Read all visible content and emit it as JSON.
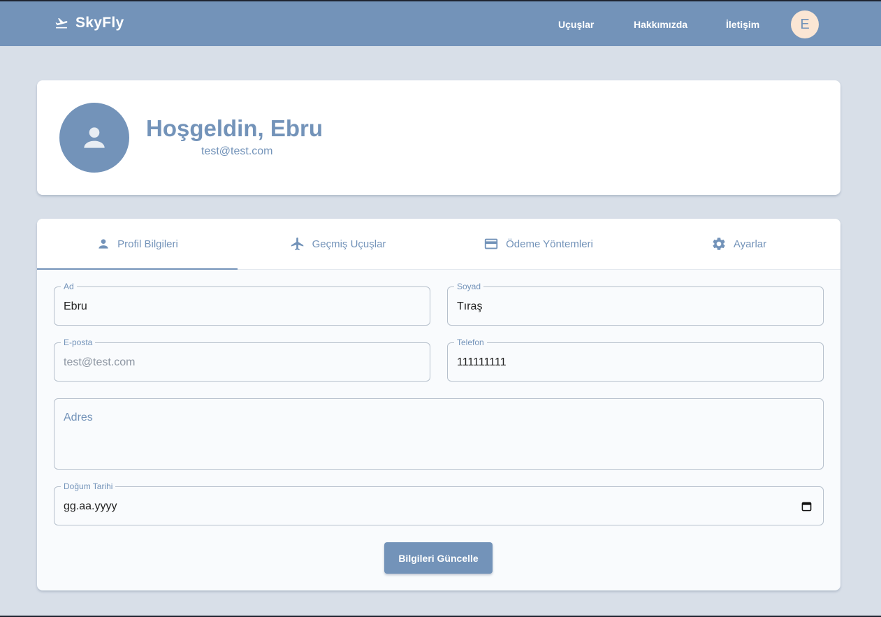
{
  "navbar": {
    "brand": "SkyFly",
    "links": [
      "Uçuşlar",
      "Hakkımızda",
      "İletişim"
    ],
    "avatar_initial": "E"
  },
  "profile": {
    "welcome": "Hoşgeldin, Ebru",
    "email": "test@test.com"
  },
  "tabs": [
    {
      "label": "Profil Bilgileri",
      "icon": "person-icon"
    },
    {
      "label": "Geçmiş Uçuşlar",
      "icon": "airplane-icon"
    },
    {
      "label": "Ödeme Yöntemleri",
      "icon": "credit-card-icon"
    },
    {
      "label": "Ayarlar",
      "icon": "gear-icon"
    }
  ],
  "form": {
    "first_name": {
      "label": "Ad",
      "value": "Ebru"
    },
    "last_name": {
      "label": "Soyad",
      "value": "Tıraş"
    },
    "email": {
      "label": "E-posta",
      "value": "test@test.com"
    },
    "phone": {
      "label": "Telefon",
      "value": "111111111"
    },
    "address": {
      "placeholder": "Adres"
    },
    "birth_date": {
      "label": "Doğum Tarihi",
      "value": "gg.aa.yyyy"
    },
    "submit_label": "Bilgileri Güncelle"
  },
  "colors": {
    "primary": "#7393b9",
    "background": "#d8dfe8",
    "avatar_bg": "#fbe6d4"
  }
}
